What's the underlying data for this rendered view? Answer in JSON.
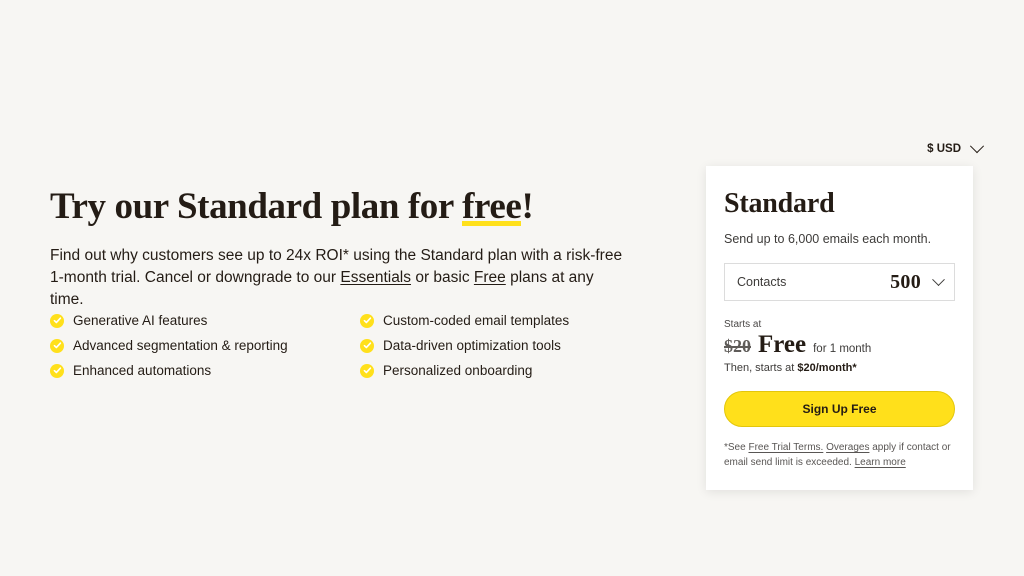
{
  "colors": {
    "page_background": "#f7f6f3",
    "card_background": "#ffffff",
    "accent_yellow": "#ffe01b",
    "text_dark": "#241c15",
    "text_muted": "#3d3b39"
  },
  "promo": {
    "heading_before": "Try our Standard plan for ",
    "heading_highlight": "free",
    "heading_after": "!",
    "paragraph_part1": "Find out why customers see up to 24x ROI* using the Standard plan with a risk-free 1-month trial. Cancel or downgrade to our ",
    "paragraph_link1": "Essentials",
    "paragraph_part2": " or basic ",
    "paragraph_link2": "Free",
    "paragraph_part3": " plans at any time."
  },
  "features": [
    {
      "label": "Generative AI features",
      "icon": "check-circle-icon"
    },
    {
      "label": "Custom-coded email templates",
      "icon": "check-circle-icon"
    },
    {
      "label": "Advanced segmentation & reporting",
      "icon": "check-circle-icon"
    },
    {
      "label": "Data-driven optimization tools",
      "icon": "check-circle-icon"
    },
    {
      "label": "Enhanced automations",
      "icon": "check-circle-icon"
    },
    {
      "label": "Personalized onboarding",
      "icon": "check-circle-icon"
    }
  ],
  "currency_selector": {
    "label": "$ USD",
    "icon": "chevron-down-icon"
  },
  "card": {
    "title": "Standard",
    "subtitle": "Send up to 6,000 emails each month.",
    "contacts_select": {
      "label": "Contacts",
      "value": "500",
      "icon": "chevron-down-icon"
    },
    "starts_at_label": "Starts at",
    "price_original": "$20",
    "price_current": "Free",
    "price_term": "for 1 month",
    "then_prefix": "Then, starts at ",
    "then_price": "$20/month*",
    "cta_label": "Sign Up Free",
    "disclaimer_part1": "*See ",
    "disclaimer_link1": "Free Trial Terms.",
    "disclaimer_part2": " ",
    "disclaimer_link2": "Overages",
    "disclaimer_part3": " apply if contact or email send limit is exceeded. ",
    "disclaimer_link3": "Learn more"
  }
}
